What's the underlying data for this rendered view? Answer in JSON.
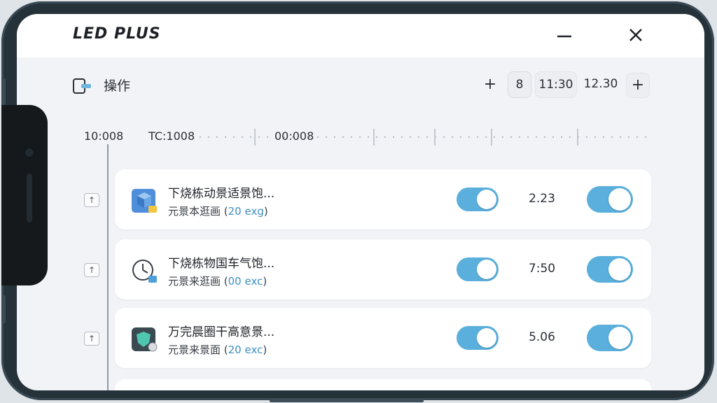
{
  "app": {
    "title": "LED PLUS"
  },
  "toolbar": {
    "label": "操作",
    "plus_left": "+",
    "chip_a": "8",
    "chip_b": "11:30",
    "chip_c": "12.30",
    "plus_right": "+"
  },
  "ruler": {
    "labels": [
      "10:008",
      "TC:1008",
      "00:008"
    ]
  },
  "rows": [
    {
      "handle": "↑",
      "icon": "cube-icon",
      "title": "下烧栋动景适景饱...",
      "sub_prefix": "元景本逛画 (",
      "sub_accent": "20 exg",
      "sub_suffix": ")",
      "toggle_1_on": true,
      "value": "2.23",
      "toggle_2_on": true
    },
    {
      "handle": "↑",
      "icon": "clock-icon",
      "title": "下烧栋物国车气饱...",
      "sub_prefix": "元景来逛画 (",
      "sub_accent": "00 exc",
      "sub_suffix": ")",
      "toggle_1_on": true,
      "value": "7:50",
      "toggle_2_on": true
    },
    {
      "handle": "↑",
      "icon": "shield-icon",
      "title": "万完晨圈干高意景...",
      "sub_prefix": "元景来景面 (",
      "sub_accent": "20 exc",
      "sub_suffix": ")",
      "toggle_1_on": true,
      "value": "5.06",
      "toggle_2_on": true
    }
  ],
  "colors": {
    "accent": "#5aafdc",
    "accent_text": "#3b8fc4",
    "frame": "#26323a",
    "screen_bg": "#f2f3f6"
  }
}
